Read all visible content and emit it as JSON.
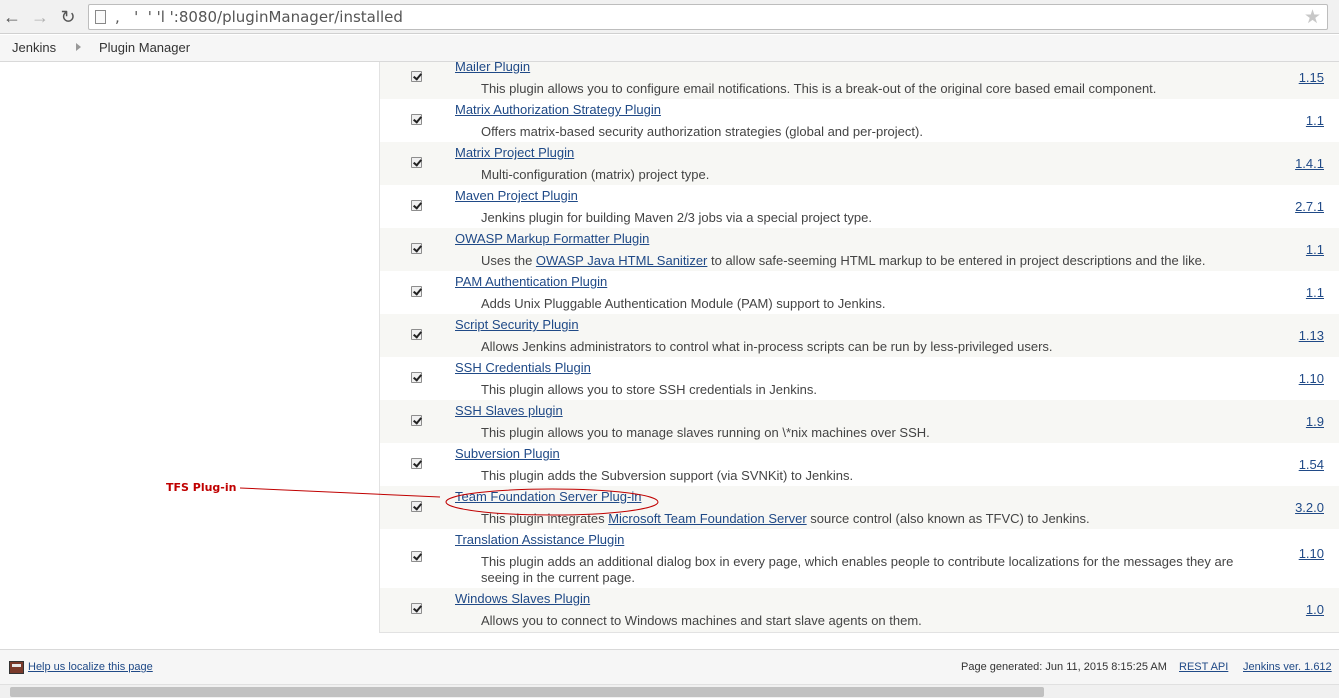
{
  "browser": {
    "url": ",   '  ' 'l ':8080/pluginManager/installed",
    "back_icon": "back-arrow-icon",
    "forward_icon": "forward-arrow-icon",
    "reload_icon": "reload-icon",
    "star_icon": "star-icon"
  },
  "breadcrumb": {
    "root": "Jenkins",
    "current": "Plugin Manager"
  },
  "plugins": [
    {
      "name": "Mailer Plugin",
      "desc": "This plugin allows you to configure email notifications. This is a break-out of the original core based email component.",
      "version": "1.15",
      "checked": true
    },
    {
      "name": "Matrix Authorization Strategy Plugin",
      "desc": "Offers matrix-based security authorization strategies (global and per-project).",
      "version": "1.1",
      "checked": true
    },
    {
      "name": "Matrix Project Plugin",
      "desc": "Multi-configuration (matrix) project type.",
      "version": "1.4.1",
      "checked": true
    },
    {
      "name": "Maven Project Plugin",
      "desc": "Jenkins plugin for building Maven 2/3 jobs via a special project type.",
      "version": "2.7.1",
      "checked": true
    },
    {
      "name": "OWASP Markup Formatter Plugin",
      "desc_pre": "Uses the ",
      "desc_link": "OWASP Java HTML Sanitizer",
      "desc_post": " to allow safe-seeming HTML markup to be entered in project descriptions and the like.",
      "version": "1.1",
      "checked": true
    },
    {
      "name": "PAM Authentication Plugin",
      "desc": "Adds Unix Pluggable Authentication Module (PAM) support to Jenkins.",
      "version": "1.1",
      "checked": true
    },
    {
      "name": "Script Security Plugin",
      "desc": "Allows Jenkins administrators to control what in-process scripts can be run by less-privileged users.",
      "version": "1.13",
      "checked": true
    },
    {
      "name": "SSH Credentials Plugin",
      "desc": "This plugin allows you to store SSH credentials in Jenkins.",
      "version": "1.10",
      "checked": true
    },
    {
      "name": "SSH Slaves plugin",
      "desc": "This plugin allows you to manage slaves running on \\*nix machines over SSH.",
      "version": "1.9",
      "checked": true
    },
    {
      "name": "Subversion Plugin",
      "desc": "This plugin adds the Subversion support (via SVNKit) to Jenkins.",
      "version": "1.54",
      "checked": true
    },
    {
      "name": "Team Foundation Server Plug-in",
      "desc_pre": "This plugin integrates ",
      "desc_link": "Microsoft Team Foundation Server",
      "desc_post": " source control (also known as TFVC) to Jenkins.",
      "version": "3.2.0",
      "checked": true
    },
    {
      "name": "Translation Assistance Plugin",
      "desc": "This plugin adds an additional dialog box in every page, which enables people to contribute localizations for the messages they are seeing in the current page.",
      "version": "1.10",
      "checked": true
    },
    {
      "name": "Windows Slaves Plugin",
      "desc": "Allows you to connect to Windows machines and start slave agents on them.",
      "version": "1.0",
      "checked": true
    }
  ],
  "annotation": {
    "label": "TFS Plug-in",
    "color": "#c00000"
  },
  "footer": {
    "localize": "Help us localize this page",
    "generated": "Page generated: Jun 11, 2015 8:15:25 AM",
    "rest_api": "REST API",
    "jenkins_version": "Jenkins ver. 1.612"
  }
}
